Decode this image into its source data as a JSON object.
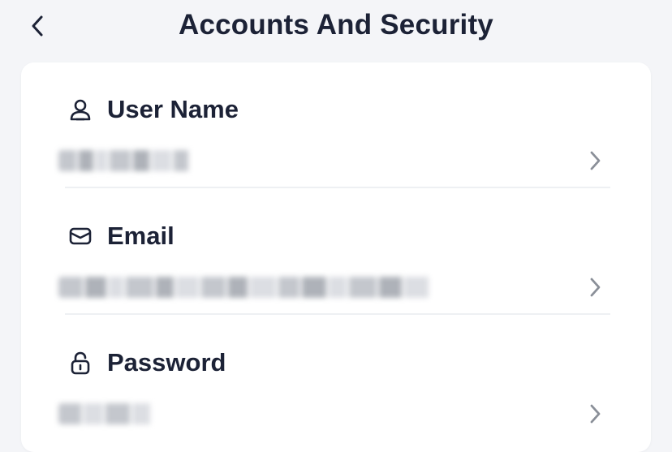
{
  "header": {
    "title": "Accounts And Security",
    "back_icon": "chevron-left-icon"
  },
  "rows": [
    {
      "label": "User Name",
      "icon": "user-icon",
      "value": "",
      "value_masked": true
    },
    {
      "label": "Email",
      "icon": "mail-icon",
      "value": "",
      "value_masked": true
    },
    {
      "label": "Password",
      "icon": "lock-icon",
      "value": "",
      "value_masked": true
    }
  ],
  "colors": {
    "background": "#f4f5f8",
    "card": "#ffffff",
    "text": "#1c2236",
    "chevron": "#8a8f98",
    "divider": "#eef0f3"
  }
}
